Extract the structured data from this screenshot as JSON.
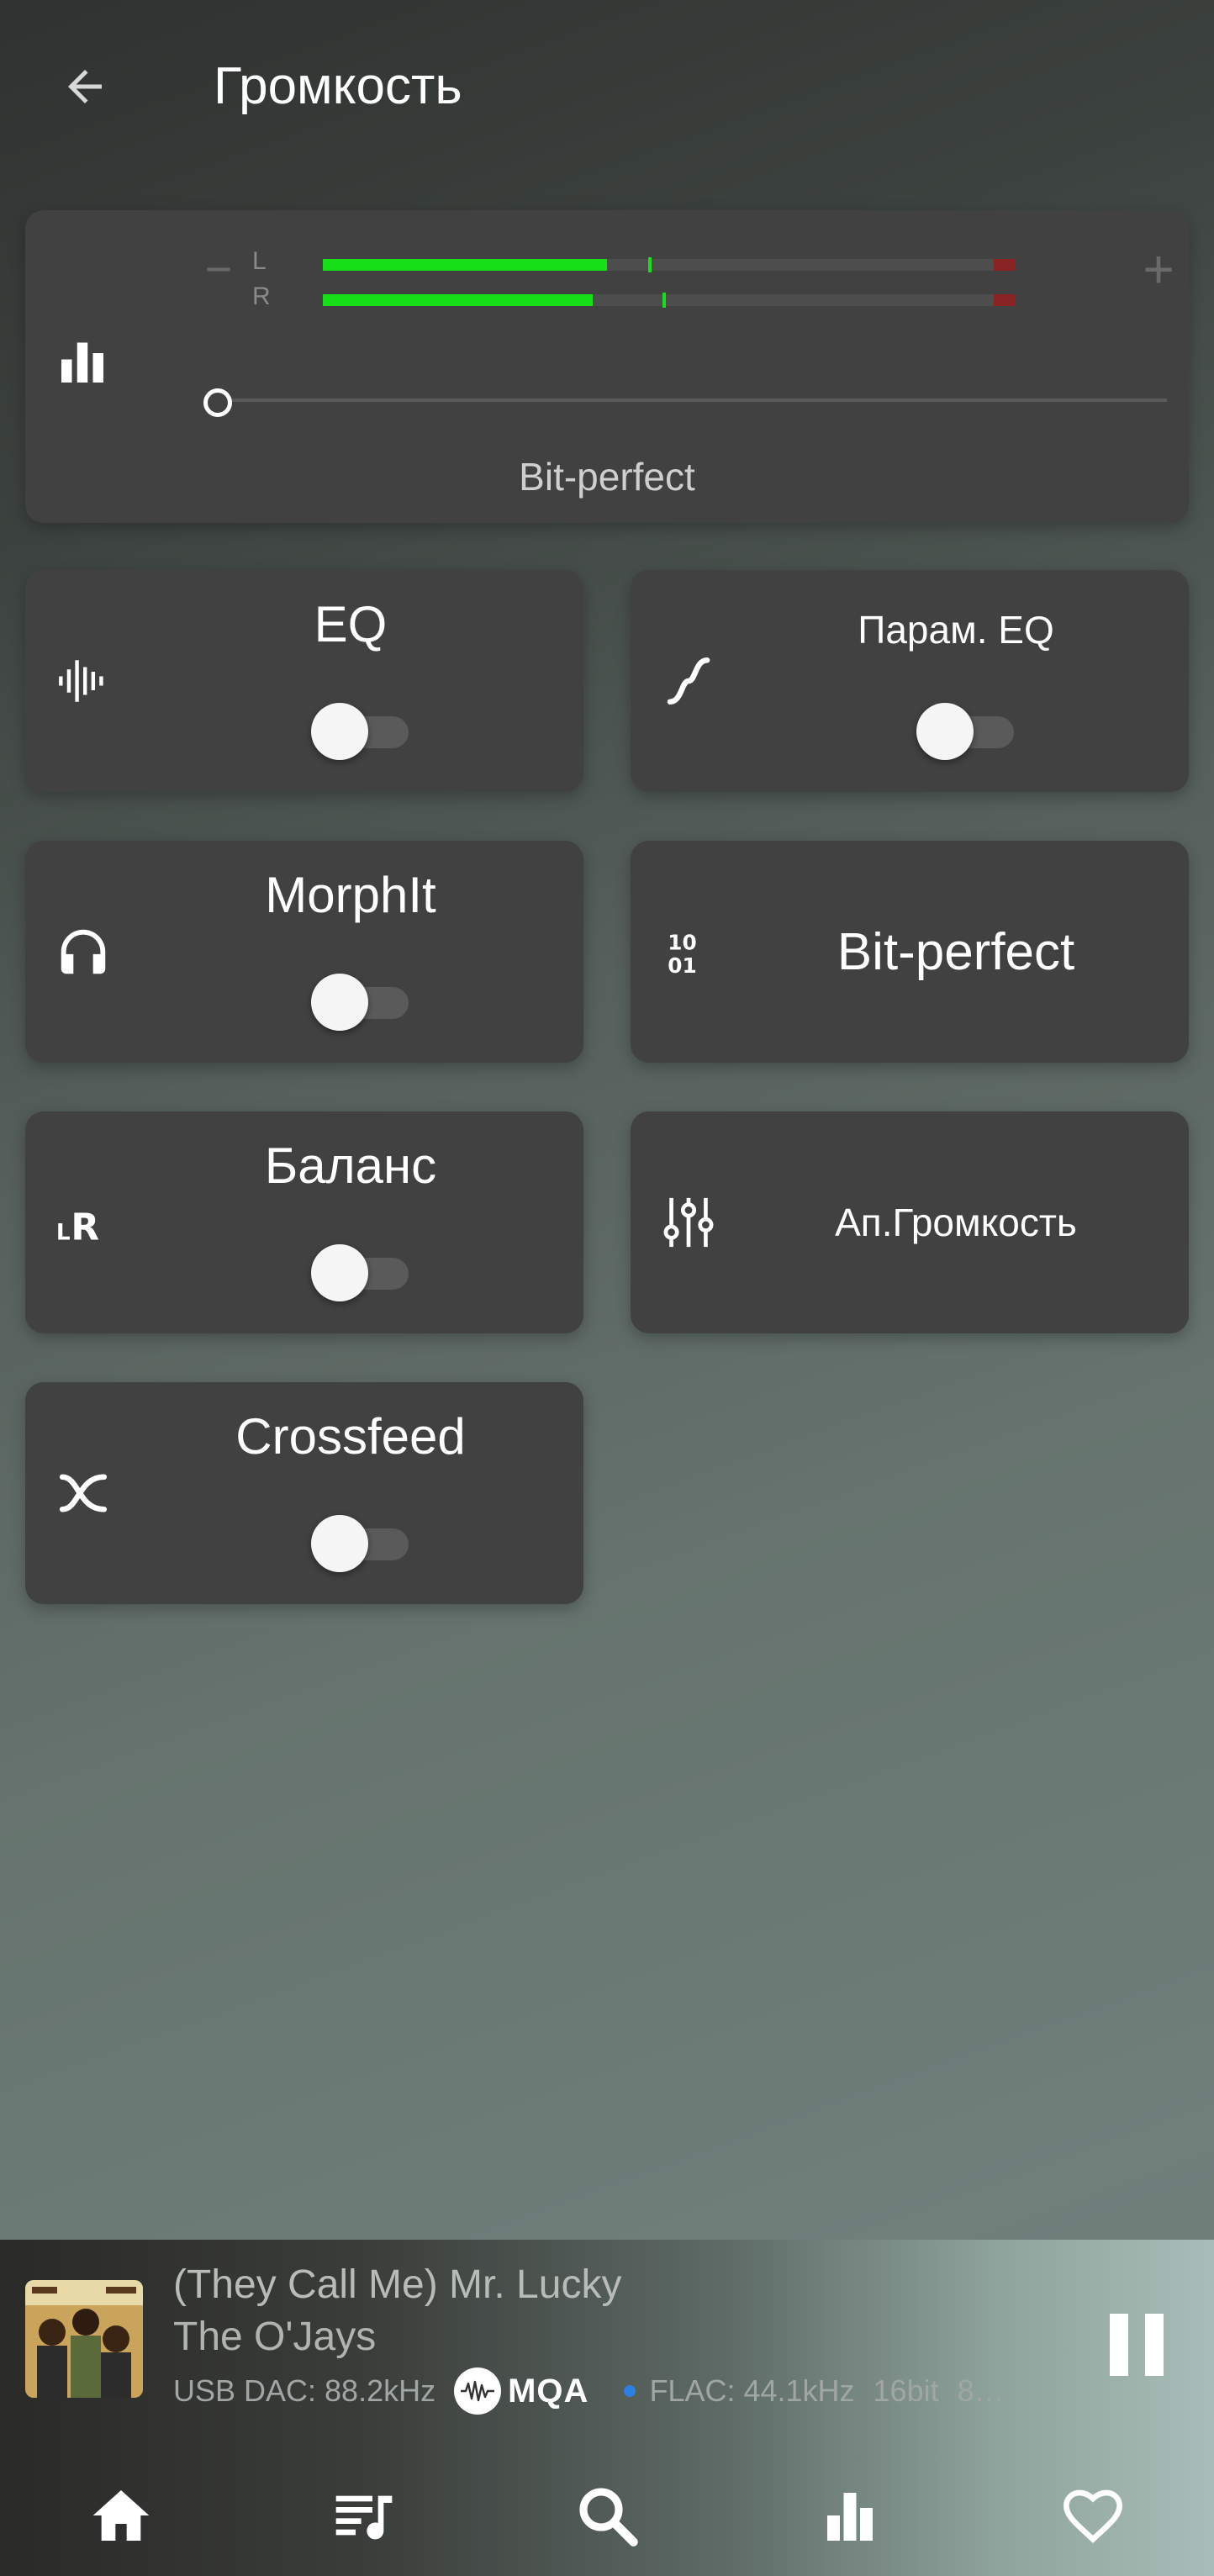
{
  "header": {
    "title": "Громкость",
    "back_icon": "arrow-back-icon"
  },
  "volume": {
    "minus_label": "−",
    "plus_label": "+",
    "left_channel_label": "L",
    "right_channel_label": "R",
    "left_level": 0.41,
    "left_peak": 0.47,
    "right_level": 0.39,
    "right_peak": 0.49,
    "slider_value": 0.0,
    "status": "Bit-perfect",
    "meter_color": "#18e018",
    "clip_color": "#8a2424"
  },
  "cards": [
    {
      "id": "eq",
      "label": "EQ",
      "icon": "waveform-icon",
      "toggle": false
    },
    {
      "id": "param_eq",
      "label": "Парам. EQ",
      "icon": "curve-icon",
      "toggle": false
    },
    {
      "id": "morphit",
      "label": "MorphIt",
      "icon": "headphones-icon",
      "toggle": false
    },
    {
      "id": "bitperfect",
      "label": "Bit-perfect",
      "icon": "binary-icon"
    },
    {
      "id": "balance",
      "label": "Баланс",
      "icon": "lr-balance-icon",
      "toggle": false
    },
    {
      "id": "hw_volume",
      "label": "Ап.Громкость",
      "icon": "sliders-icon"
    },
    {
      "id": "crossfeed",
      "label": "Crossfeed",
      "icon": "crossfeed-icon",
      "toggle": false
    }
  ],
  "now_playing": {
    "title": "(They Call Me) Mr. Lucky",
    "artist": "The O'Jays",
    "output": "USB DAC: 88.2kHz",
    "mqa_label": "MQA",
    "format": "FLAC: 44.1kHz",
    "bit_depth": "16bit",
    "extra": "8…",
    "is_playing": true
  },
  "bottom_nav": [
    {
      "id": "home",
      "icon": "home-icon"
    },
    {
      "id": "queue",
      "icon": "queue-music-icon"
    },
    {
      "id": "search",
      "icon": "search-icon"
    },
    {
      "id": "levels",
      "icon": "bar-chart-icon"
    },
    {
      "id": "favorites",
      "icon": "heart-icon"
    }
  ]
}
